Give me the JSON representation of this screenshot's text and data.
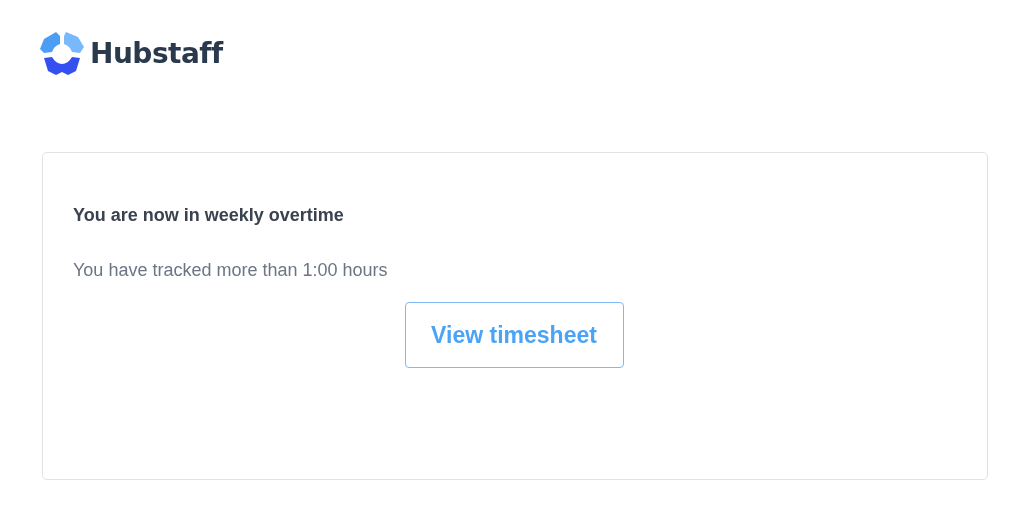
{
  "brand": {
    "name": "Hubstaff"
  },
  "notice": {
    "title": "You are now in weekly overtime",
    "message": "You have tracked more than 1:00 hours",
    "button": "View timesheet"
  }
}
